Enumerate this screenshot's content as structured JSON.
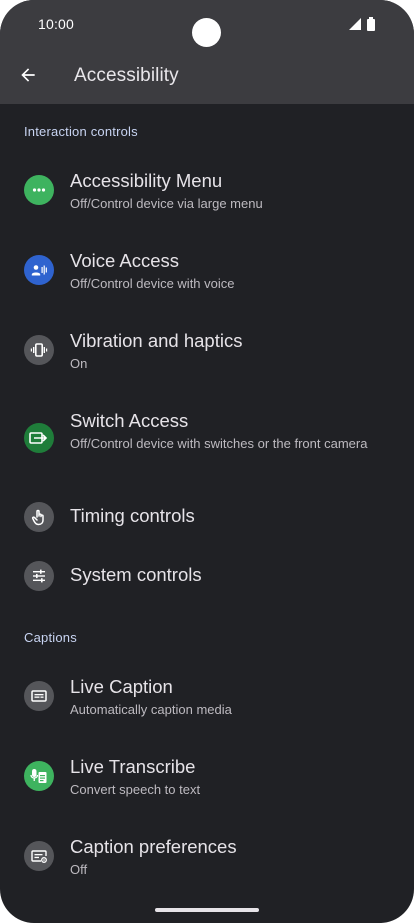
{
  "status_bar": {
    "time": "10:00"
  },
  "app_bar": {
    "title": "Accessibility"
  },
  "sections": [
    {
      "header": "Interaction controls",
      "items": [
        {
          "title": "Accessibility Menu",
          "subtitle": "Off/Control device via large menu",
          "icon": "more-horizontal-icon",
          "icon_bg": "#3eb35f"
        },
        {
          "title": "Voice Access",
          "subtitle": "Off/Control device with voice",
          "icon": "voice-access-icon",
          "icon_bg": "#2f63cf"
        },
        {
          "title": "Vibration and haptics",
          "subtitle": "On",
          "icon": "vibration-icon",
          "icon_bg": "#55565a"
        },
        {
          "title": "Switch Access",
          "subtitle": "Off/Control device with switches or the front camera",
          "icon": "switch-access-icon",
          "icon_bg": "#1f7d3a"
        },
        {
          "title": "Timing controls",
          "subtitle": "",
          "icon": "touch-hand-icon",
          "icon_bg": "#55565a"
        },
        {
          "title": "System controls",
          "subtitle": "",
          "icon": "sliders-icon",
          "icon_bg": "#55565a"
        }
      ]
    },
    {
      "header": "Captions",
      "items": [
        {
          "title": "Live Caption",
          "subtitle": "Automatically caption media",
          "icon": "live-caption-icon",
          "icon_bg": "#55565a"
        },
        {
          "title": "Live Transcribe",
          "subtitle": "Convert speech to text",
          "icon": "live-transcribe-icon",
          "icon_bg": "#3eb35f"
        },
        {
          "title": "Caption preferences",
          "subtitle": "Off",
          "icon": "caption-settings-icon",
          "icon_bg": "#55565a"
        }
      ]
    }
  ],
  "colors": {
    "background": "#202125",
    "app_bar": "#3c3c40",
    "section_header": "#c8d4f2",
    "title_text": "#e6e3e8",
    "subtitle_text": "#bdbac0"
  }
}
